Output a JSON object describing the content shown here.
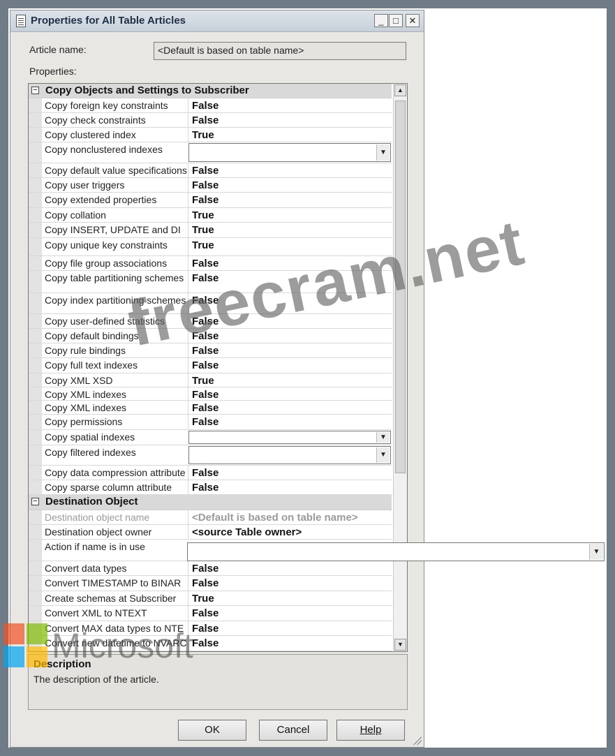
{
  "window": {
    "title": "Properties for All Table Articles",
    "minimize": "_",
    "maximize": "□",
    "close": "✕"
  },
  "article_name": {
    "label": "Article name:",
    "value": "<Default is based on table name>"
  },
  "properties_label": "Properties:",
  "categories": {
    "copy": "Copy Objects and Settings to Subscriber",
    "destination": "Destination Object"
  },
  "rows": [
    {
      "name": "Copy foreign key constraints",
      "value": "False"
    },
    {
      "name": "Copy check constraints",
      "value": "False"
    },
    {
      "name": "Copy clustered index",
      "value": "True"
    },
    {
      "name": "Copy nonclustered indexes",
      "value": ""
    },
    {
      "name": "Copy default value specifications",
      "value": "False"
    },
    {
      "name": "Copy user triggers",
      "value": "False"
    },
    {
      "name": "Copy extended properties",
      "value": "False"
    },
    {
      "name": "Copy collation",
      "value": "True"
    },
    {
      "name": "Copy INSERT, UPDATE and DI",
      "value": "True"
    },
    {
      "name": "Copy unique key constraints",
      "value": "True"
    },
    {
      "name": "Copy file group associations",
      "value": "False"
    },
    {
      "name": "Copy table partitioning schemes",
      "value": "False"
    },
    {
      "name": "Copy index partitioning schemes",
      "value": "False"
    },
    {
      "name": "Copy user-defined statistics",
      "value": "False"
    },
    {
      "name": "Copy default bindings",
      "value": "False"
    },
    {
      "name": "Copy rule bindings",
      "value": "False"
    },
    {
      "name": "Copy full text indexes",
      "value": "False"
    },
    {
      "name": "Copy XML XSD",
      "value": "True"
    },
    {
      "name": "Copy XML indexes",
      "value": "False"
    },
    {
      "name": "Copy XML indexes",
      "value": "False"
    },
    {
      "name": "Copy permissions",
      "value": "False"
    },
    {
      "name": "Copy spatial indexes",
      "value": ""
    },
    {
      "name": "Copy filtered indexes",
      "value": ""
    },
    {
      "name": "Copy data compression attribute",
      "value": "False"
    },
    {
      "name": "Copy sparse column attribute",
      "value": "False"
    },
    {
      "name": "Destination object name",
      "value": "<Default is based on table name>"
    },
    {
      "name": "Destination object owner",
      "value": "<source Table owner>"
    },
    {
      "name": "Action if name is in use",
      "value": ""
    },
    {
      "name": "Convert data types",
      "value": "False"
    },
    {
      "name": "Convert TIMESTAMP to BINAR",
      "value": "False"
    },
    {
      "name": "Create schemas at Subscriber",
      "value": "True"
    },
    {
      "name": "Convert XML to NTEXT",
      "value": "False"
    },
    {
      "name": "Convert MAX data types to NTE",
      "value": "False"
    },
    {
      "name": "Convert new datetime to NVARC",
      "value": "False"
    }
  ],
  "description": {
    "title": "Description",
    "text": "The description of the article."
  },
  "buttons": {
    "ok": "OK",
    "cancel": "Cancel",
    "help": "Help"
  },
  "watermarks": {
    "site": "freecram.net",
    "brand": "Microsoft"
  },
  "colors": {
    "ms_red": "#f25022",
    "ms_green": "#7fba00",
    "ms_blue": "#00a4ef",
    "ms_yellow": "#ffb900"
  }
}
